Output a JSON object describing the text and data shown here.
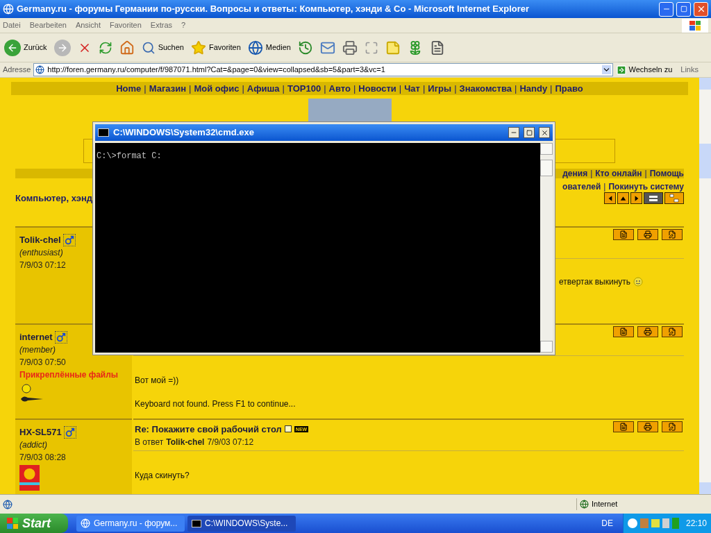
{
  "window": {
    "title": "Germany.ru - форумы Германии по-русски. Вопросы и ответы: Компьютер, хэнди & Co - Microsoft Internet Explorer"
  },
  "menu": [
    "Datei",
    "Bearbeiten",
    "Ansicht",
    "Favoriten",
    "Extras",
    "?"
  ],
  "toolbar": [
    {
      "kind": "back",
      "label": "Zurück"
    },
    {
      "kind": "forward"
    },
    {
      "kind": "stop"
    },
    {
      "kind": "refresh"
    },
    {
      "kind": "home"
    },
    {
      "kind": "search",
      "label": "Suchen"
    },
    {
      "kind": "favorites",
      "label": "Favoriten"
    },
    {
      "kind": "media",
      "label": "Medien"
    },
    {
      "kind": "history"
    },
    {
      "kind": "mail"
    },
    {
      "kind": "print"
    },
    {
      "kind": "edit"
    },
    {
      "kind": "notes"
    },
    {
      "kind": "flower"
    },
    {
      "kind": "messenger"
    }
  ],
  "address": {
    "label": "Adresse",
    "url": "http://foren.germany.ru/computer/f/987071.html?Cat=&page=0&view=collapsed&sb=5&part=3&vc=1",
    "go": "Wechseln zu",
    "links": "Links"
  },
  "nav": [
    {
      "kind": "link",
      "text": "Home"
    },
    {
      "kind": "sep",
      "text": "|"
    },
    {
      "kind": "link",
      "text": "Магазин"
    },
    {
      "kind": "sep",
      "text": "|"
    },
    {
      "kind": "link",
      "text": "Мой офис"
    },
    {
      "kind": "sep",
      "text": "|"
    },
    {
      "kind": "link",
      "text": "Афиша"
    },
    {
      "kind": "sep",
      "text": "|"
    },
    {
      "kind": "link",
      "text": "TOP100"
    },
    {
      "kind": "sep",
      "text": "|"
    },
    {
      "kind": "link",
      "text": "Авто"
    },
    {
      "kind": "sep",
      "text": "|"
    },
    {
      "kind": "link",
      "text": "Новости"
    },
    {
      "kind": "sep",
      "text": "|"
    },
    {
      "kind": "link",
      "text": "Чат"
    },
    {
      "kind": "sep",
      "text": "|"
    },
    {
      "kind": "link",
      "text": "Игры"
    },
    {
      "kind": "sep",
      "text": "|"
    },
    {
      "kind": "link",
      "text": "Знакомства"
    },
    {
      "kind": "sep",
      "text": "|"
    },
    {
      "kind": "link",
      "text": "Handy"
    },
    {
      "kind": "sep",
      "text": "|"
    },
    {
      "kind": "link",
      "text": "Право"
    }
  ],
  "forum_links": [
    [
      {
        "kind": "link",
        "text": "дения"
      },
      {
        "kind": "sep",
        "text": "|"
      },
      {
        "kind": "link",
        "text": "Кто онлайн"
      },
      {
        "kind": "sep",
        "text": "|"
      },
      {
        "kind": "link",
        "text": "Помощь"
      }
    ],
    [
      {
        "kind": "link",
        "text": "ователей"
      },
      {
        "kind": "sep",
        "text": "|"
      },
      {
        "kind": "link",
        "text": "Покинуть систему"
      }
    ]
  ],
  "forum_title": "Компьютер, хэнд",
  "view_buttons": [
    {
      "kind": "prev",
      "selected": false
    },
    {
      "kind": "up",
      "selected": false
    },
    {
      "kind": "next",
      "selected": false
    },
    {
      "kind": "flat",
      "selected": true
    },
    {
      "kind": "tree",
      "selected": false
    }
  ],
  "posts": [
    {
      "author": "Tolik-chel",
      "rank": "(enthusiast)",
      "date": "7/9/03 07:12",
      "body": [
        {
          "text": "етвертак выкинуть",
          "smiley": true
        }
      ]
    },
    {
      "author": "internet",
      "rank": "(member)",
      "date": "7/9/03 07:50",
      "attachments": "Прикреплённые файлы",
      "avatar": {
        "kind": "guitar"
      },
      "body": [
        {
          "text": "Вот мой =))",
          "smiley": false
        },
        {
          "text": "Keyboard not found. Press F1 to continue...",
          "smiley": false
        }
      ]
    },
    {
      "author": "HX-SL571",
      "rank": "(addict)",
      "date": "7/9/03 08:28",
      "avatar": {
        "kind": "emblem"
      },
      "title": "Re: Покажите свой рабочий стол",
      "badge": "NEW",
      "reply": {
        "prefix": "В ответ",
        "author": "Tolik-chel",
        "date": "7/9/03 07:12"
      },
      "body": [
        {
          "text": "Куда скинуть?",
          "smiley": false
        }
      ]
    }
  ],
  "cmd": {
    "title": "C:\\WINDOWS\\System32\\cmd.exe",
    "lines": [
      "C:\\>format C:"
    ]
  },
  "status_bar": {
    "zone": "Internet"
  },
  "taskbar": {
    "start": "Start",
    "tasks": [
      {
        "kind": "ie",
        "label": "Germany.ru - форум...",
        "selected": false
      },
      {
        "kind": "cmd",
        "label": "C:\\WINDOWS\\Syste...",
        "selected": true
      }
    ],
    "language": "DE",
    "clock": "22:10"
  }
}
